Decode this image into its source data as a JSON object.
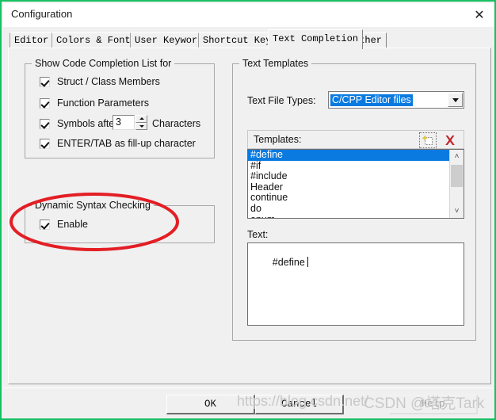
{
  "window": {
    "title": "Configuration",
    "close_icon": "close-icon",
    "border_color": "#16c060"
  },
  "tabs": [
    {
      "label": "Editor",
      "active": false
    },
    {
      "label": "Colors & Fonts",
      "active": false
    },
    {
      "label": "User Keywords",
      "active": false
    },
    {
      "label": "Shortcut Keys",
      "active": false
    },
    {
      "label": "Text Completion",
      "active": true
    },
    {
      "label": "Other",
      "active": false
    }
  ],
  "left": {
    "completion_group": {
      "legend": "Show Code Completion List for",
      "options": [
        {
          "label": "Struct / Class Members",
          "checked": true
        },
        {
          "label": "Function Parameters",
          "checked": true
        },
        {
          "label": "Symbols after",
          "checked": true
        },
        {
          "label": "ENTER/TAB as fill-up character",
          "checked": true
        }
      ],
      "symbols_after_value": "3",
      "symbols_after_suffix": "Characters"
    },
    "syntax_group": {
      "legend": "Dynamic Syntax Checking",
      "enable_label": "Enable",
      "enable_checked": true,
      "highlight_color": "#e31e24"
    }
  },
  "right": {
    "legend": "Text Templates",
    "file_types_label": "Text File Types:",
    "file_types_value": "C/CPP Editor files",
    "templates_label": "Templates:",
    "new_icon": "new-template-icon",
    "delete_icon": "delete-template-icon",
    "templates": [
      "#define",
      "#if",
      "#include",
      "Header",
      "continue",
      "do",
      "enum"
    ],
    "selected_template": "#define",
    "text_label": "Text:",
    "text_value": "#define"
  },
  "buttons": {
    "ok": "OK",
    "cancel": "Cancel",
    "help": "Help"
  },
  "watermark": {
    "url": "https://blog.csdn.net/",
    "author": "CSDN @塔克Tark"
  }
}
